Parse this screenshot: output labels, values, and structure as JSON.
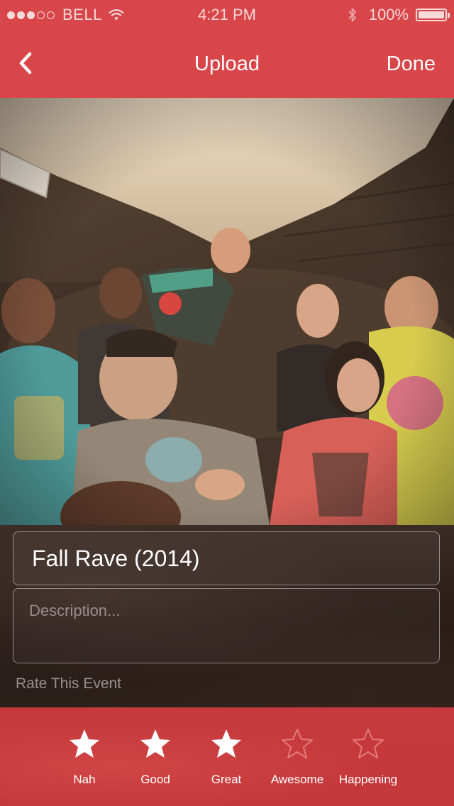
{
  "status_bar": {
    "carrier": "BELL",
    "time": "4:21 PM",
    "battery": "100%",
    "signal_bars_filled": 3,
    "signal_bars_total": 5,
    "battery_level": 1.0
  },
  "nav": {
    "title": "Upload",
    "done_label": "Done",
    "back_icon": "chevron-left-icon"
  },
  "form": {
    "title_value": "Fall Rave (2014)",
    "description_placeholder": "Description...",
    "rate_label": "Rate This Event"
  },
  "rating": {
    "selected_count": 3,
    "options": [
      {
        "label": "Nah",
        "filled": true
      },
      {
        "label": "Good",
        "filled": true
      },
      {
        "label": "Great",
        "filled": true
      },
      {
        "label": "Awesome",
        "filled": false
      },
      {
        "label": "Happening",
        "filled": false
      }
    ]
  },
  "colors": {
    "accent": "#d9464a",
    "rating_bar": "#c4383c",
    "star_filled": "#ffffff",
    "star_outline": "#e47a7c"
  }
}
